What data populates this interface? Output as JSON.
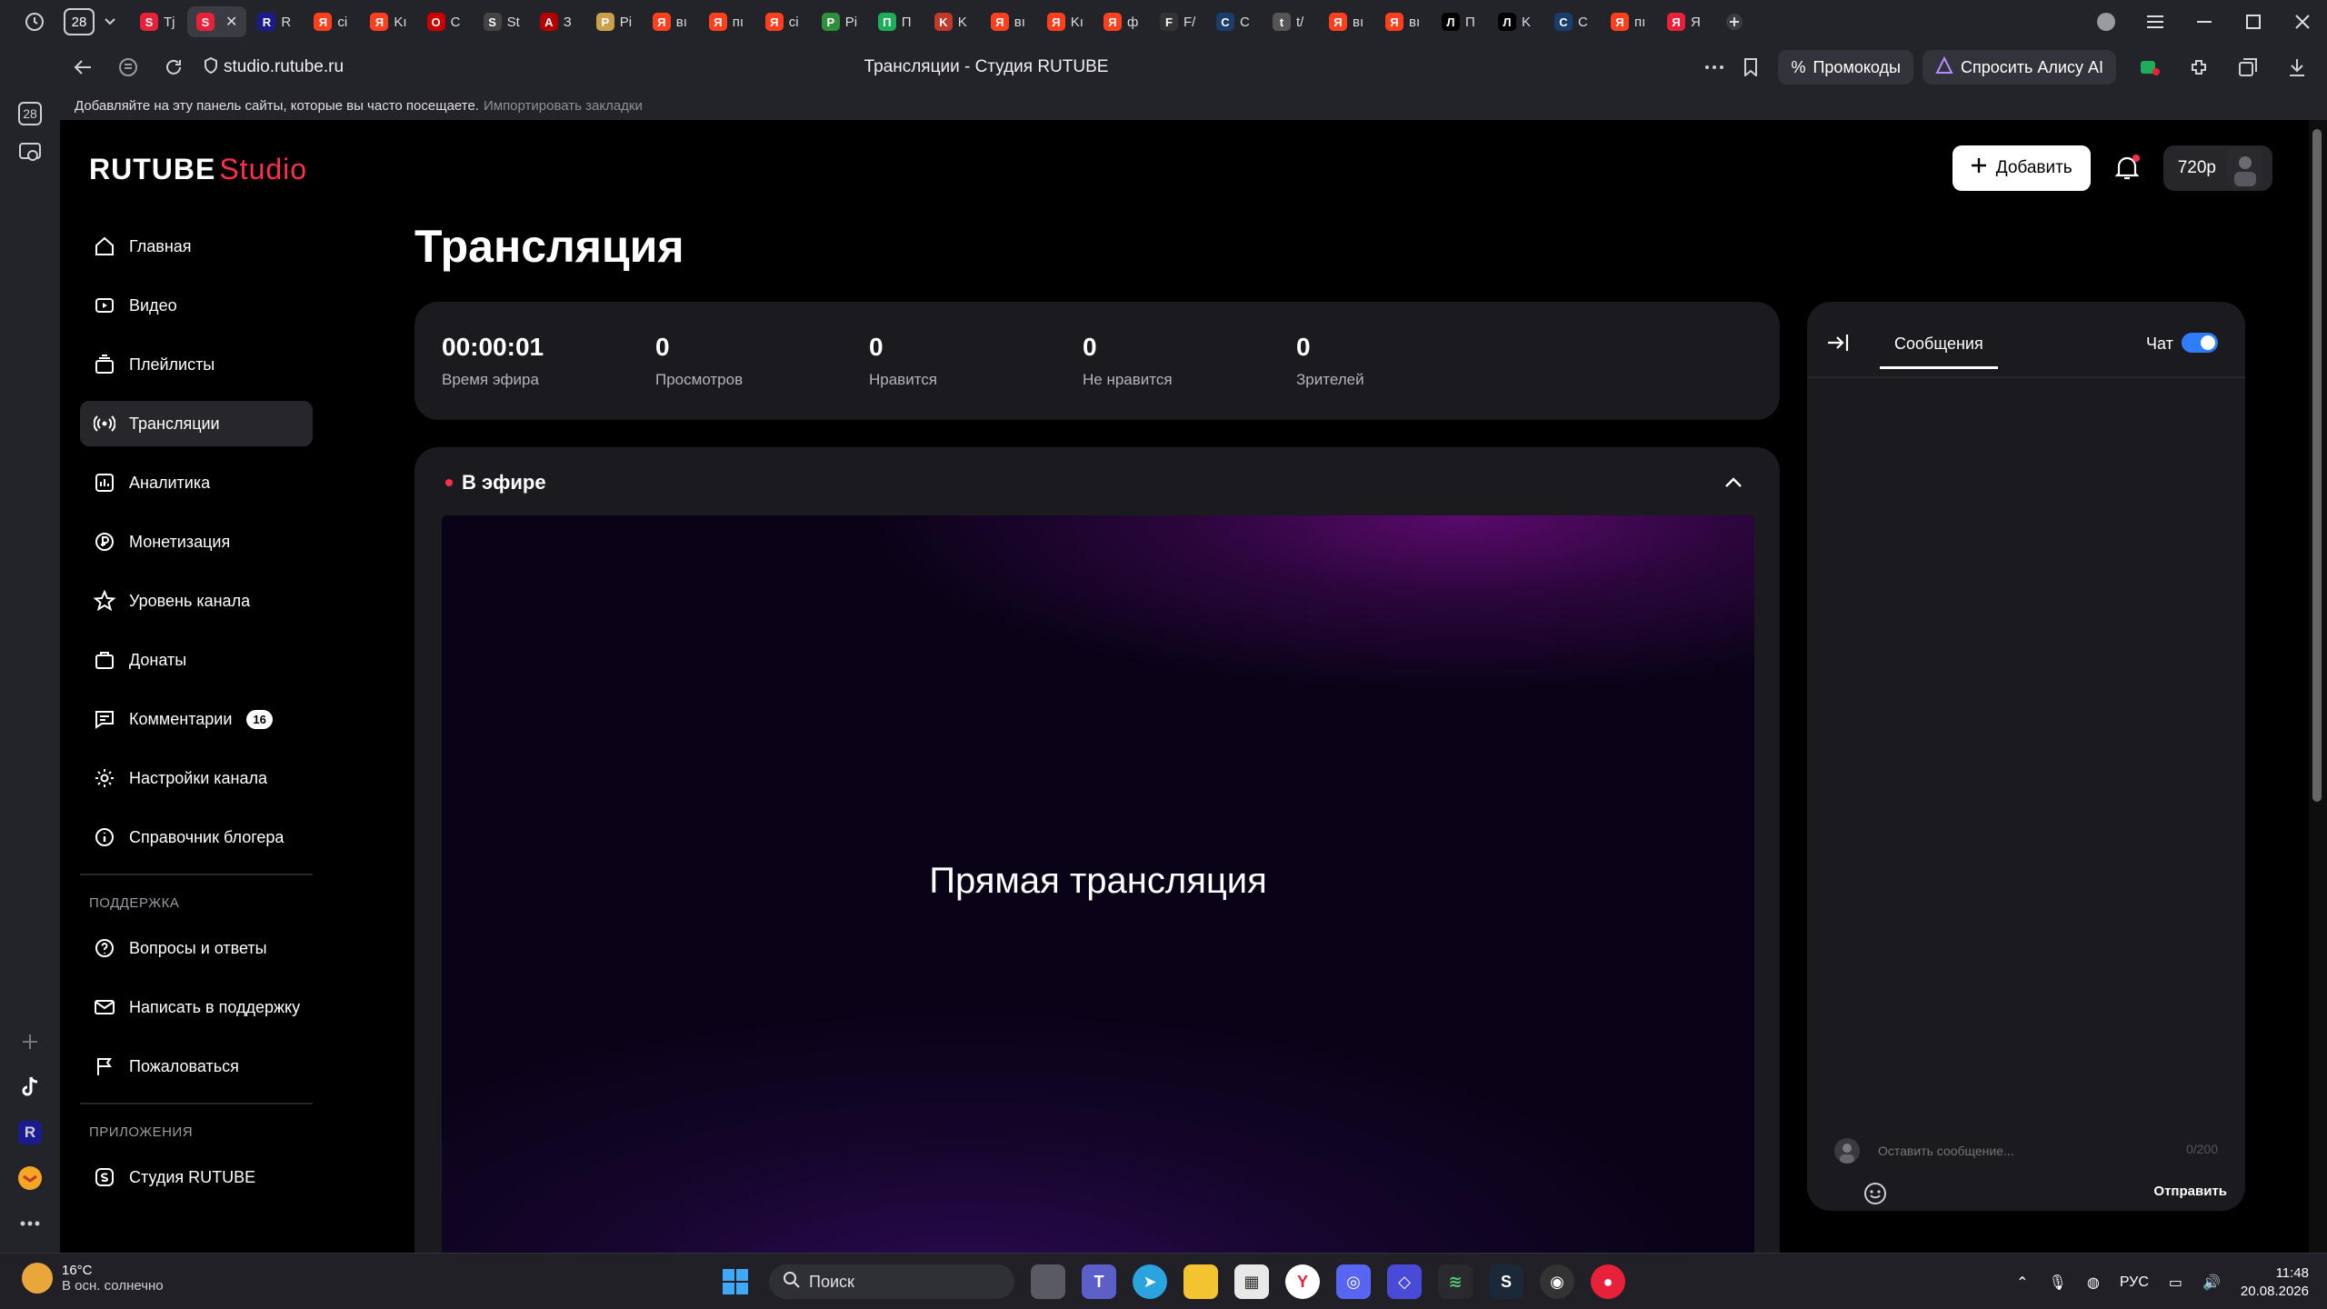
{
  "browser": {
    "tab_count": "28",
    "tabs": [
      {
        "fav": "S",
        "color": "#e8213a",
        "title": "Тj"
      },
      {
        "fav": "S",
        "color": "#e8213a",
        "title": "",
        "active": true
      },
      {
        "fav": "R",
        "color": "#1b1b8f",
        "title": "R"
      },
      {
        "fav": "Я",
        "color": "#fc3f1d",
        "title": "ci"
      },
      {
        "fav": "Я",
        "color": "#fc3f1d",
        "title": "Kı"
      },
      {
        "fav": "O",
        "color": "#cc0000",
        "title": "С"
      },
      {
        "fav": "S",
        "color": "#444",
        "title": "St"
      },
      {
        "fav": "A",
        "color": "#b30000",
        "title": "З"
      },
      {
        "fav": "P",
        "color": "#caa04a",
        "title": "Pi"
      },
      {
        "fav": "Я",
        "color": "#fc3f1d",
        "title": "вı"
      },
      {
        "fav": "Я",
        "color": "#fc3f1d",
        "title": "пı"
      },
      {
        "fav": "Я",
        "color": "#fc3f1d",
        "title": "ci"
      },
      {
        "fav": "P",
        "color": "#2f8f3a",
        "title": "Pi"
      },
      {
        "fav": "П",
        "color": "#1eae5a",
        "title": "П"
      },
      {
        "fav": "K",
        "color": "#c0392b",
        "title": "K"
      },
      {
        "fav": "Я",
        "color": "#fc3f1d",
        "title": "вı"
      },
      {
        "fav": "Я",
        "color": "#fc3f1d",
        "title": "Kı"
      },
      {
        "fav": "Я",
        "color": "#fc3f1d",
        "title": "ф"
      },
      {
        "fav": "F",
        "color": "#333",
        "title": "F/"
      },
      {
        "fav": "С",
        "color": "#1a3e6b",
        "title": "С"
      },
      {
        "fav": "t",
        "color": "#555",
        "title": "t/"
      },
      {
        "fav": "Я",
        "color": "#fc3f1d",
        "title": "вı"
      },
      {
        "fav": "Я",
        "color": "#fc3f1d",
        "title": "вı"
      },
      {
        "fav": "Л",
        "color": "#000",
        "title": "П"
      },
      {
        "fav": "Л",
        "color": "#000",
        "title": "K"
      },
      {
        "fav": "С",
        "color": "#1a3e6b",
        "title": "С"
      },
      {
        "fav": "Я",
        "color": "#fc3f1d",
        "title": "пı"
      },
      {
        "fav": "Я",
        "color": "#e8213a",
        "title": "Я"
      }
    ],
    "url": "studio.rutube.ru",
    "page_title": "Трансляции - Студия RUTUBE",
    "promo_label": "Промокоды",
    "alice_label": "Спросить Алису AI",
    "bookmark_hint": "Добавляйте на эту панель сайты, которые вы часто посещаете.",
    "bookmark_import": "Импортировать закладки",
    "sidepanel_badge": "28"
  },
  "app": {
    "logo_main": "RUTUBE",
    "logo_sub": "Studio",
    "add_button": "Добавить",
    "quality": "720p",
    "page_title": "Трансляция",
    "nav": [
      {
        "label": "Главная",
        "icon": "home-icon"
      },
      {
        "label": "Видео",
        "icon": "video-icon"
      },
      {
        "label": "Плейлисты",
        "icon": "playlist-icon"
      },
      {
        "label": "Трансляции",
        "icon": "broadcast-icon",
        "active": true
      },
      {
        "label": "Аналитика",
        "icon": "analytics-icon"
      },
      {
        "label": "Монетизация",
        "icon": "monetization-icon"
      },
      {
        "label": "Уровень канала",
        "icon": "star-icon"
      },
      {
        "label": "Донаты",
        "icon": "donate-icon"
      },
      {
        "label": "Комментарии",
        "icon": "comment-icon",
        "badge": "16"
      },
      {
        "label": "Настройки канала",
        "icon": "gear-icon"
      },
      {
        "label": "Справочник блогера",
        "icon": "info-icon"
      }
    ],
    "support_label": "ПОДДЕРЖКА",
    "support": [
      {
        "label": "Вопросы и ответы",
        "icon": "help-icon"
      },
      {
        "label": "Написать в поддержку",
        "icon": "mail-icon"
      },
      {
        "label": "Пожаловаться",
        "icon": "flag-icon"
      }
    ],
    "apps_label": "ПРИЛОЖЕНИЯ",
    "apps": [
      {
        "label": "Студия RUTUBE",
        "icon": "studio-app-icon"
      }
    ],
    "stats": [
      {
        "value": "00:00:01",
        "label": "Время эфира"
      },
      {
        "value": "0",
        "label": "Просмотров"
      },
      {
        "value": "0",
        "label": "Нравится"
      },
      {
        "value": "0",
        "label": "Не нравится"
      },
      {
        "value": "0",
        "label": "Зрителей"
      }
    ],
    "live_label": "В эфире",
    "video_text": "Прямая трансляция",
    "chat": {
      "tab_label": "Сообщения",
      "toggle_label": "Чат",
      "toggle_on": true,
      "input_placeholder": "Оставить сообщение...",
      "counter": "0/200",
      "send_label": "Отправить"
    }
  },
  "taskbar": {
    "temp": "16°C",
    "weather": "В осн. солнечно",
    "search_label": "Поиск",
    "lang": "РУС",
    "time": "11:48",
    "date": "20.08.2026"
  }
}
